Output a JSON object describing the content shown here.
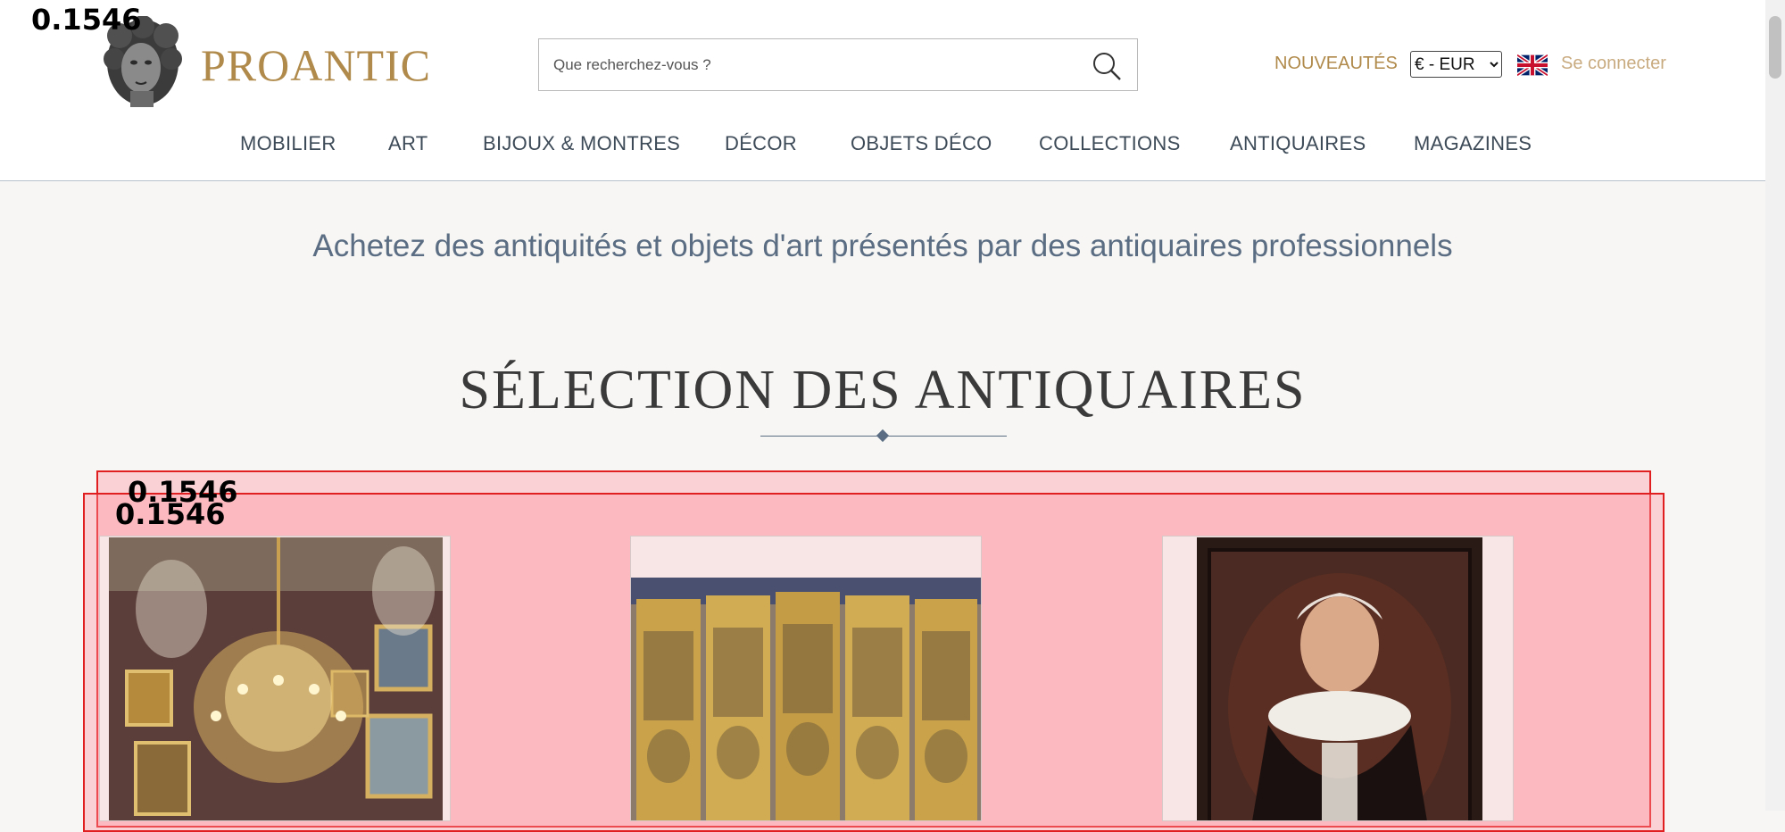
{
  "overlay": {
    "score_top": "0.1546",
    "score_box1": "0.1546",
    "score_box2": "0.1546"
  },
  "header": {
    "logo_text": "PROANTIC",
    "search_placeholder": "Que recherchez-vous ?",
    "new_label": "NOUVEAUTÉS",
    "currency_selected": "€ - EUR",
    "login_label": "Se connecter"
  },
  "nav": {
    "items": [
      {
        "label": "MOBILIER"
      },
      {
        "label": "ART"
      },
      {
        "label": "BIJOUX & MONTRES"
      },
      {
        "label": "DÉCOR"
      },
      {
        "label": "OBJETS DÉCO"
      },
      {
        "label": "COLLECTIONS"
      },
      {
        "label": "ANTIQUAIRES"
      },
      {
        "label": "MAGAZINES"
      }
    ]
  },
  "main": {
    "tagline": "Achetez des antiquités et objets d'art présentés par des antiquaires professionnels",
    "section_title": "SÉLECTION DES ANTIQUAIRES"
  },
  "colors": {
    "accent_gold": "#b08a4a",
    "nav_text": "#3d4a57",
    "tagline": "#5a6d82",
    "highlight": "#e02020"
  }
}
